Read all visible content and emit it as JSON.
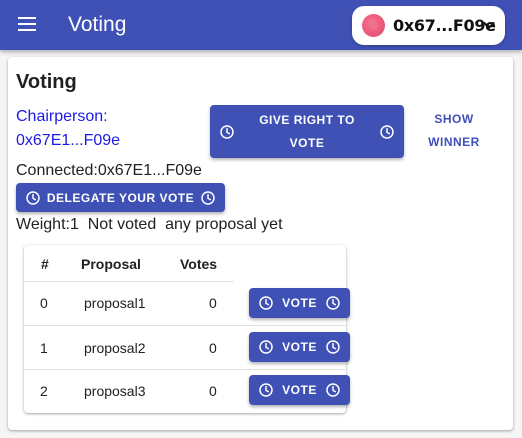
{
  "appbar": {
    "title": "Voting",
    "account_address": "0x67...F09e"
  },
  "card": {
    "title": "Voting",
    "chairperson_label": "Chairperson:",
    "chairperson_address": "0x67E1...F09e",
    "give_right_line1": "GIVE RIGHT TO",
    "give_right_line2": "VOTE",
    "show_winner_line1": "SHOW",
    "show_winner_line2": "WINNER",
    "connected": "Connected:0x67E1...F09e",
    "delegate_label": "DELEGATE YOUR VOTE",
    "weight": "Weight:1  Not voted  any proposal yet"
  },
  "table": {
    "headers": [
      "#",
      "Proposal",
      "Votes"
    ],
    "rows": [
      {
        "index": "0",
        "proposal": "proposal1",
        "votes": "0",
        "action": "VOTE"
      },
      {
        "index": "1",
        "proposal": "proposal2",
        "votes": "0",
        "action": "VOTE"
      },
      {
        "index": "2",
        "proposal": "proposal3",
        "votes": "0",
        "action": "VOTE"
      }
    ]
  },
  "colors": {
    "primary": "#3f51b5",
    "link": "#1a1ae8"
  },
  "icons": {
    "menu": "menu-icon",
    "button": "clock-icon",
    "account": "chevron-down-icon"
  }
}
